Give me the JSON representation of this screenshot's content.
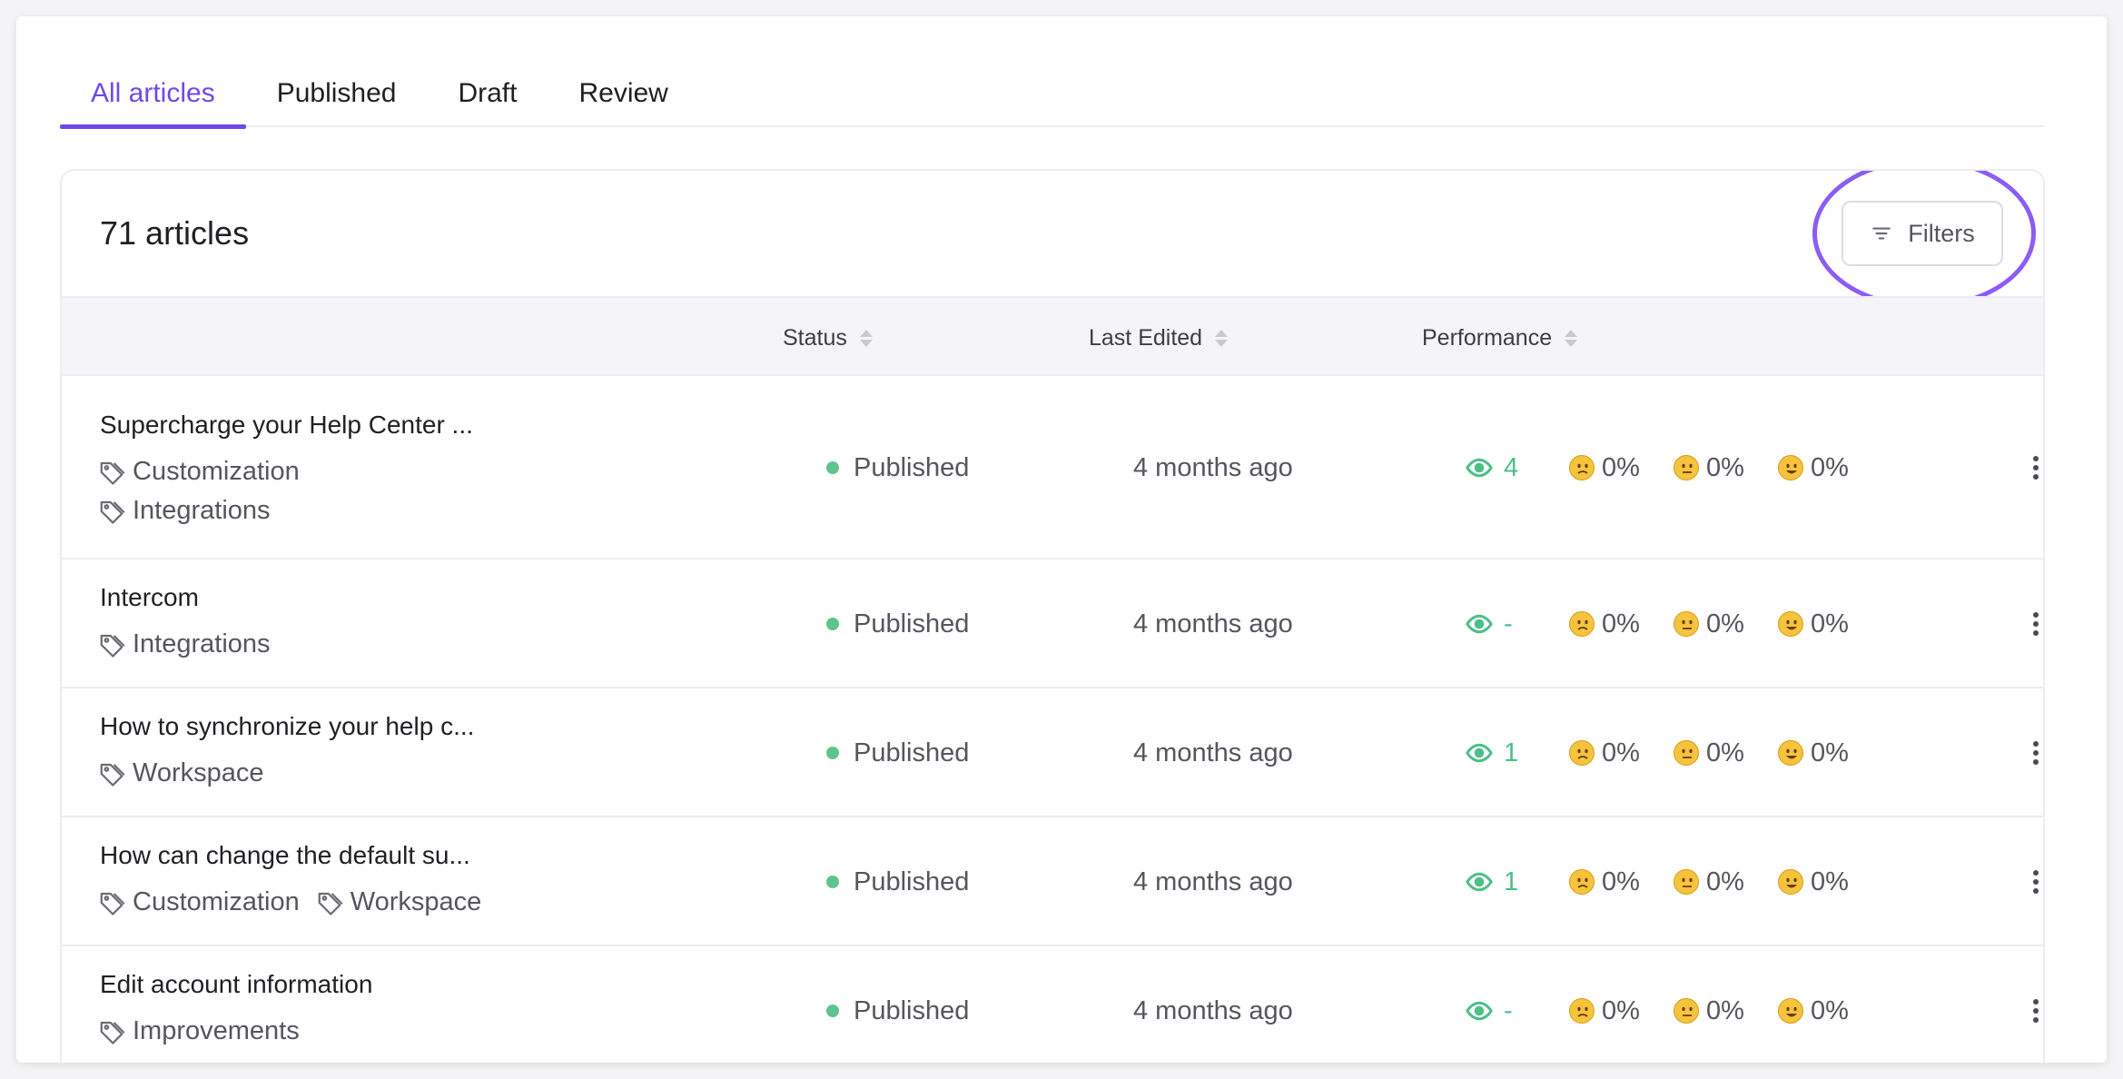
{
  "tabs": [
    {
      "label": "All articles",
      "active": true
    },
    {
      "label": "Published",
      "active": false
    },
    {
      "label": "Draft",
      "active": false
    },
    {
      "label": "Review",
      "active": false
    }
  ],
  "header": {
    "count_label": "71 articles",
    "filters_label": "Filters"
  },
  "columns": {
    "status": "Status",
    "last_edited": "Last Edited",
    "performance": "Performance"
  },
  "colors": {
    "accent": "#6d4ae8",
    "highlight_ring": "#8b5cf6",
    "status_published": "#5ec48d",
    "views": "#4cbf86"
  },
  "rows": [
    {
      "title": "Supercharge your Help Center ...",
      "tags": [
        [
          "Customization"
        ],
        [
          "Integrations"
        ]
      ],
      "status": "Published",
      "last_edited": "4 months ago",
      "views": "4",
      "sad": "0%",
      "neutral": "0%",
      "happy": "0%"
    },
    {
      "title": "Intercom",
      "tags": [
        [
          "Integrations"
        ]
      ],
      "status": "Published",
      "last_edited": "4 months ago",
      "views": "-",
      "sad": "0%",
      "neutral": "0%",
      "happy": "0%"
    },
    {
      "title": "How to synchronize your help c...",
      "tags": [
        [
          "Workspace"
        ]
      ],
      "status": "Published",
      "last_edited": "4 months ago",
      "views": "1",
      "sad": "0%",
      "neutral": "0%",
      "happy": "0%"
    },
    {
      "title": "How can change the default su...",
      "tags": [
        [
          "Customization",
          "Workspace"
        ]
      ],
      "status": "Published",
      "last_edited": "4 months ago",
      "views": "1",
      "sad": "0%",
      "neutral": "0%",
      "happy": "0%"
    },
    {
      "title": "Edit account information",
      "tags": [
        [
          "Improvements"
        ]
      ],
      "status": "Published",
      "last_edited": "4 months ago",
      "views": "-",
      "sad": "0%",
      "neutral": "0%",
      "happy": "0%"
    }
  ],
  "icons": {
    "filter": "filter-icon",
    "tag": "tag-icon",
    "views": "eye-icon",
    "sad": "sad-face-icon",
    "neutral": "neutral-face-icon",
    "happy": "happy-face-icon",
    "more": "more-vertical-icon",
    "sort": "sort-icon"
  }
}
